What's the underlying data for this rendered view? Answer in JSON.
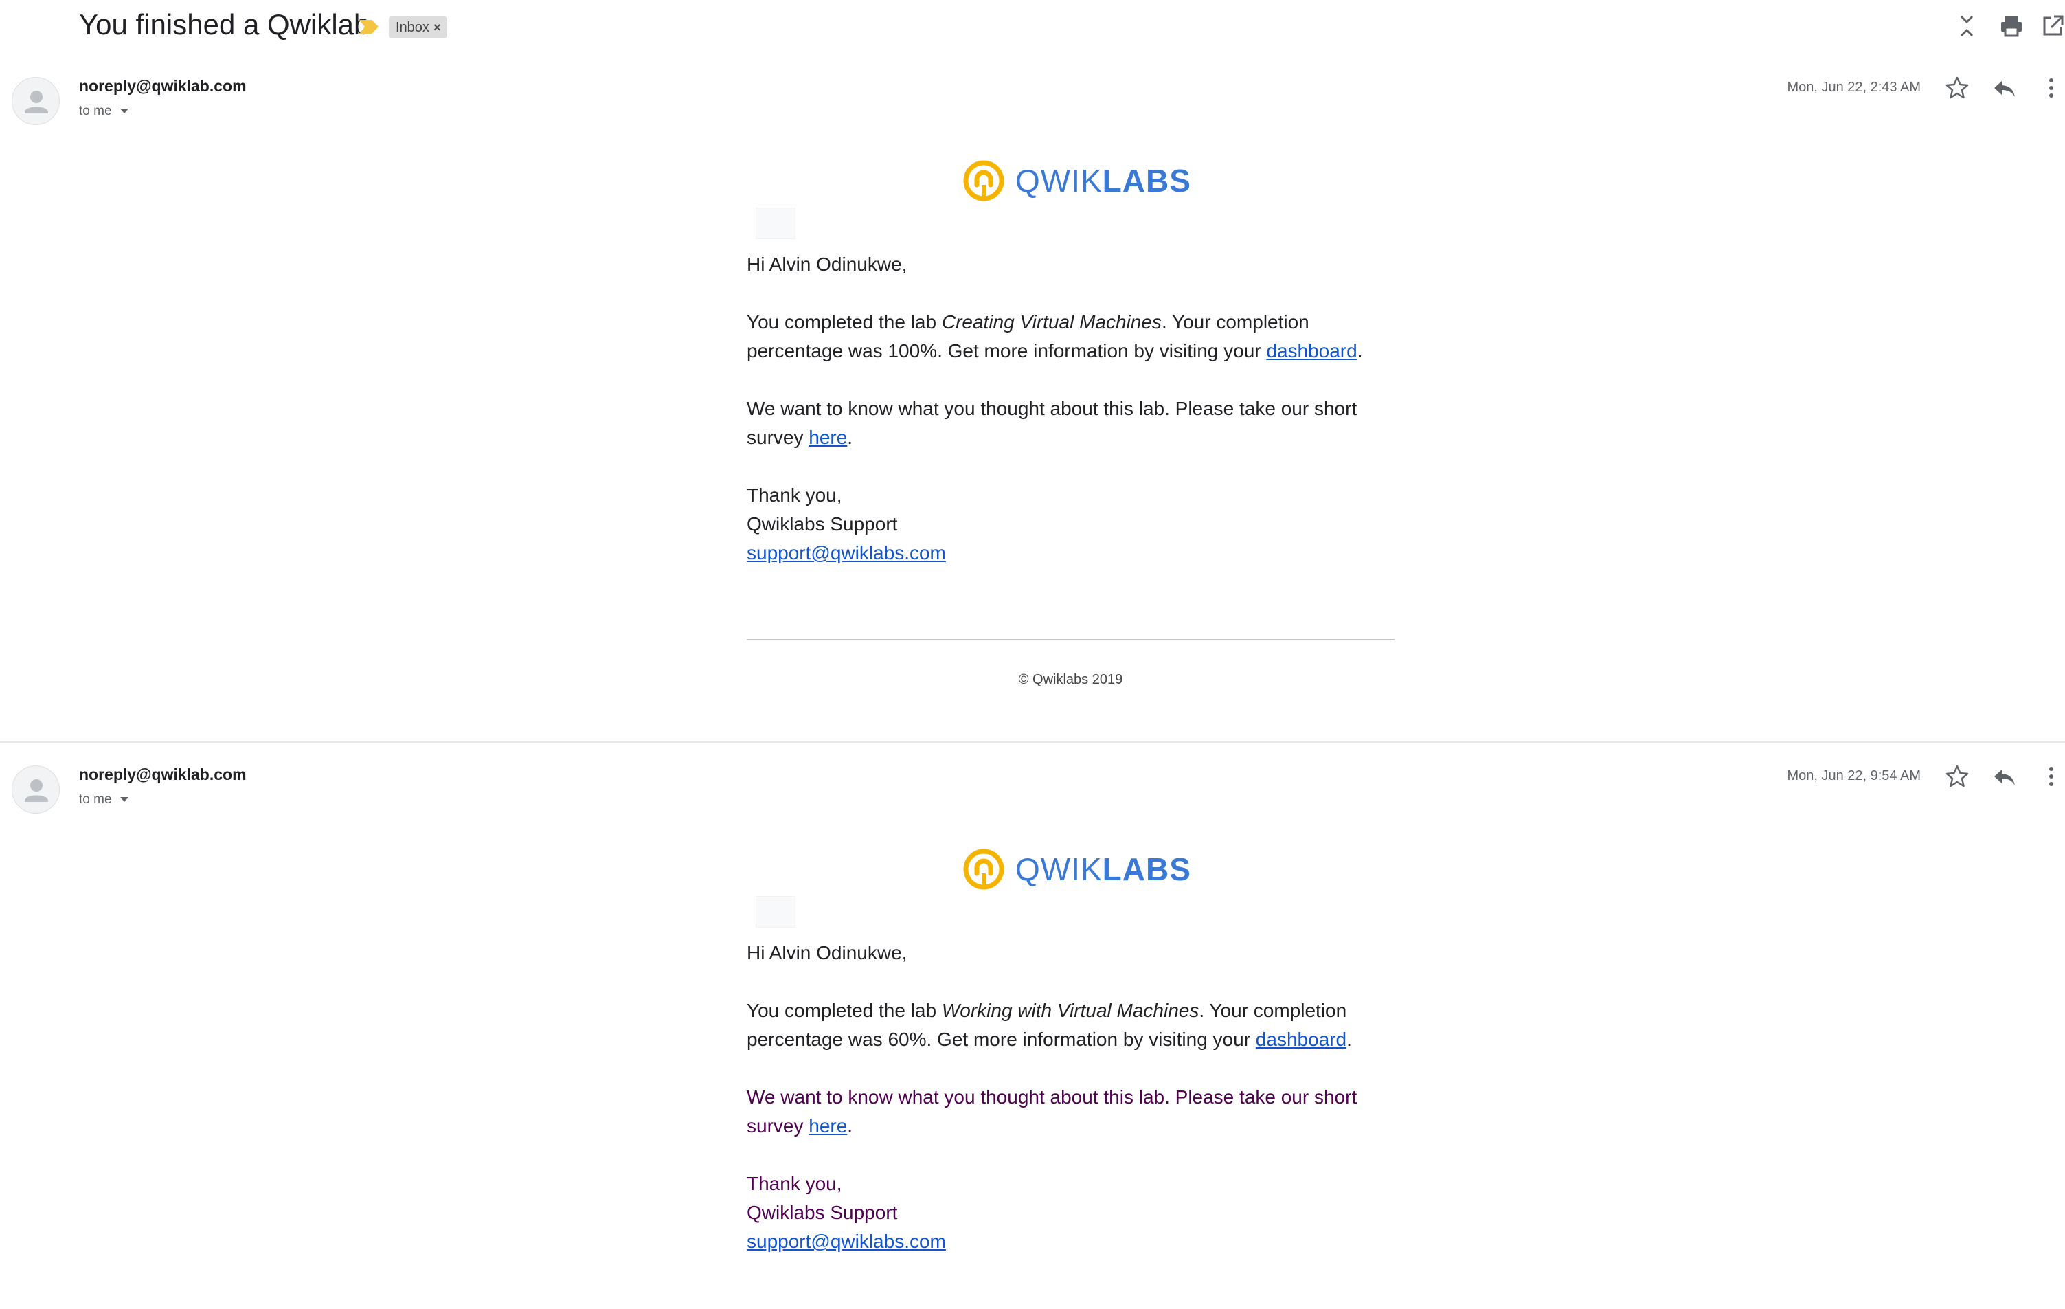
{
  "header": {
    "subject": "You finished a Qwiklab",
    "label_chip": "Inbox",
    "label_remove": "×",
    "icons": [
      "collapse-all-icon",
      "print-icon",
      "open-in-new-window-icon"
    ]
  },
  "messages": [
    {
      "sender": "noreply@qwiklab.com",
      "recipient": "to me",
      "date": "Mon, Jun 22, 2:43 AM",
      "logo": {
        "light": "QWIK",
        "bold": "LABS"
      },
      "greeting": "Hi Alvin Odinukwe,",
      "completion_prefix": "You completed the lab ",
      "lab_name": "Creating Virtual Machines",
      "completion_middle": ". Your completion percentage was 100%. Get more information by visiting your ",
      "dashboard_link": "dashboard",
      "completion_suffix": ".",
      "survey_prefix": "We want to know what you thought about this lab. Please take our short survey ",
      "survey_link": "here",
      "survey_suffix": ".",
      "signoff": "Thank you,",
      "signature": "Qwiklabs Support",
      "support_email": "support@qwiklabs.com",
      "copyright": "© Qwiklabs 2019"
    },
    {
      "sender": "noreply@qwiklab.com",
      "recipient": "to me",
      "date": "Mon, Jun 22, 9:54 AM",
      "logo": {
        "light": "QWIK",
        "bold": "LABS"
      },
      "greeting": "Hi Alvin Odinukwe,",
      "completion_prefix": "You completed the lab ",
      "lab_name": "Working with Virtual Machines",
      "completion_middle": ". Your completion percentage was 60%. Get more information by visiting your ",
      "dashboard_link": "dashboard",
      "completion_suffix": ".",
      "survey_prefix": "We want to know what you thought about this lab. Please take our short survey ",
      "survey_link": "here",
      "survey_suffix": ".",
      "signoff": "Thank you,",
      "signature": "Qwiklabs Support",
      "support_email": "support@qwiklabs.com"
    }
  ],
  "colors": {
    "link": "#1155cc",
    "logo_blue": "#3b79d6",
    "logo_yellow": "#f4b400",
    "quoted_text": "#500050",
    "importance_marker": "#f4c542"
  }
}
